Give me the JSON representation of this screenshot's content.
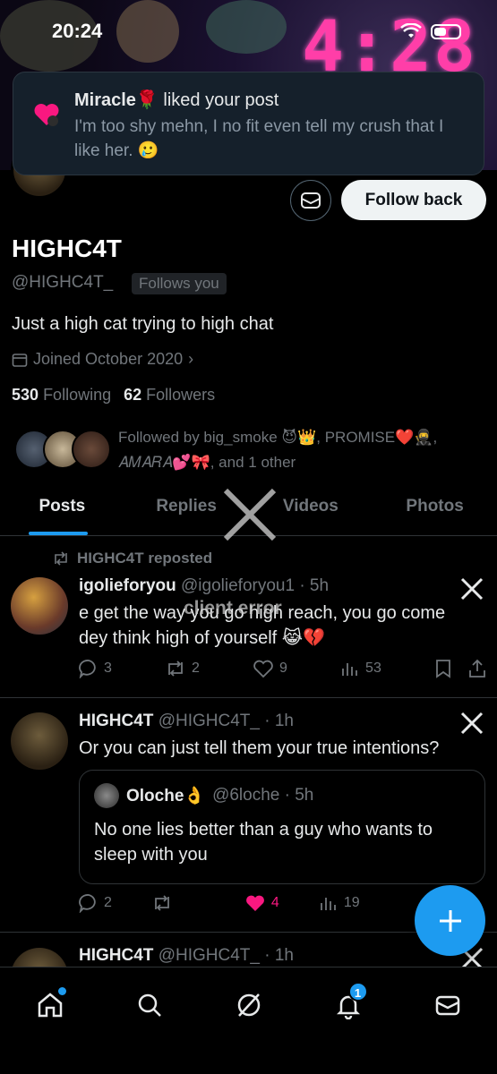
{
  "status_bar": {
    "time": "20:24"
  },
  "banner": {
    "clock": "4:28"
  },
  "notification": {
    "user": "Miracle🌹",
    "action": " liked your post",
    "body": "I'm too shy mehn, I no fit even tell my crush that I like her. 🥲"
  },
  "profile": {
    "follow_label": "Follow back",
    "name": "HIGHC4T",
    "handle": "@HIGHC4T_",
    "follows_you": "Follows you",
    "bio": "Just a high cat trying to high chat",
    "joined": "Joined October 2020",
    "following_count": "530",
    "following_label": "Following",
    "followers_count": "62",
    "followers_label": "Followers",
    "followed_by": "Followed by big_smoke 😈👑, PROMISE❤️🥷, 𝐴𝑀𝐴𝑅𝐴💕🎀, and 1 other"
  },
  "tabs": [
    "Posts",
    "Replies",
    "Videos",
    "Photos"
  ],
  "overlay": {
    "error_text": "client error"
  },
  "posts": [
    {
      "repost": "HIGHC4T reposted",
      "name": "igolieforyou",
      "meta": "@igolieforyou1 · 5h",
      "text": "e get the way you go high reach, you go come dey think high of yourself 😹💔",
      "replies": "3",
      "reposts": "2",
      "likes": "9",
      "views": "53"
    },
    {
      "name": "HIGHC4T",
      "meta": "@HIGHC4T_ · 1h",
      "text": "Or you can just tell them your true intentions?",
      "quote": {
        "name": "Oloche👌",
        "meta": "@6loche · 5h",
        "text": "No one lies better than a guy who wants to sleep with you"
      },
      "replies": "2",
      "likes": "4",
      "views": "19"
    },
    {
      "name": "HIGHC4T",
      "meta": "@HIGHC4T_ · 1h"
    }
  ],
  "nav": {
    "notif_badge": "1"
  },
  "colors": {
    "accent": "#1d9bf0",
    "like": "#f91880",
    "clock": "#ff3ea8"
  }
}
